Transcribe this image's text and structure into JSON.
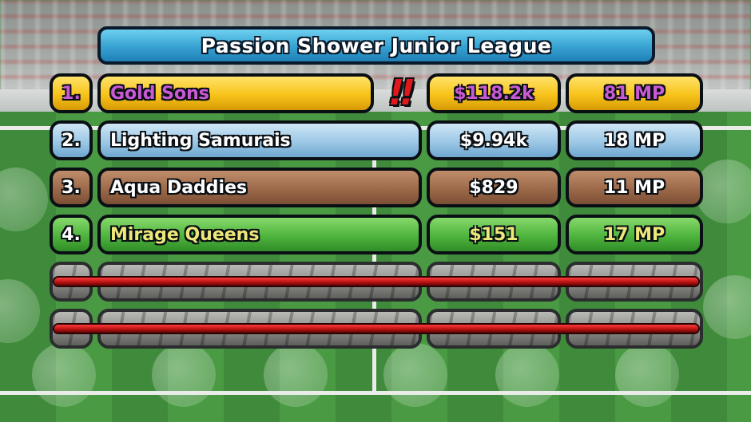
{
  "title": "Passion Shower Junior League",
  "rows": [
    {
      "rank": "1.",
      "name": "Gold Sons",
      "money": "$118.2k",
      "mp": "81 MP",
      "alert": "!!",
      "color": "#f7c31a"
    },
    {
      "rank": "2.",
      "name": "Lighting Samurais",
      "money": "$9.94k",
      "mp": "18 MP",
      "color": "#9cc8e6"
    },
    {
      "rank": "3.",
      "name": "Aqua Daddies",
      "money": "$829",
      "mp": "11 MP",
      "color": "#9c6a4a"
    },
    {
      "rank": "4.",
      "name": "Mirage Queens",
      "money": "$151",
      "mp": "17 MP",
      "color": "#4fb43d"
    }
  ],
  "locked_rows": 2
}
